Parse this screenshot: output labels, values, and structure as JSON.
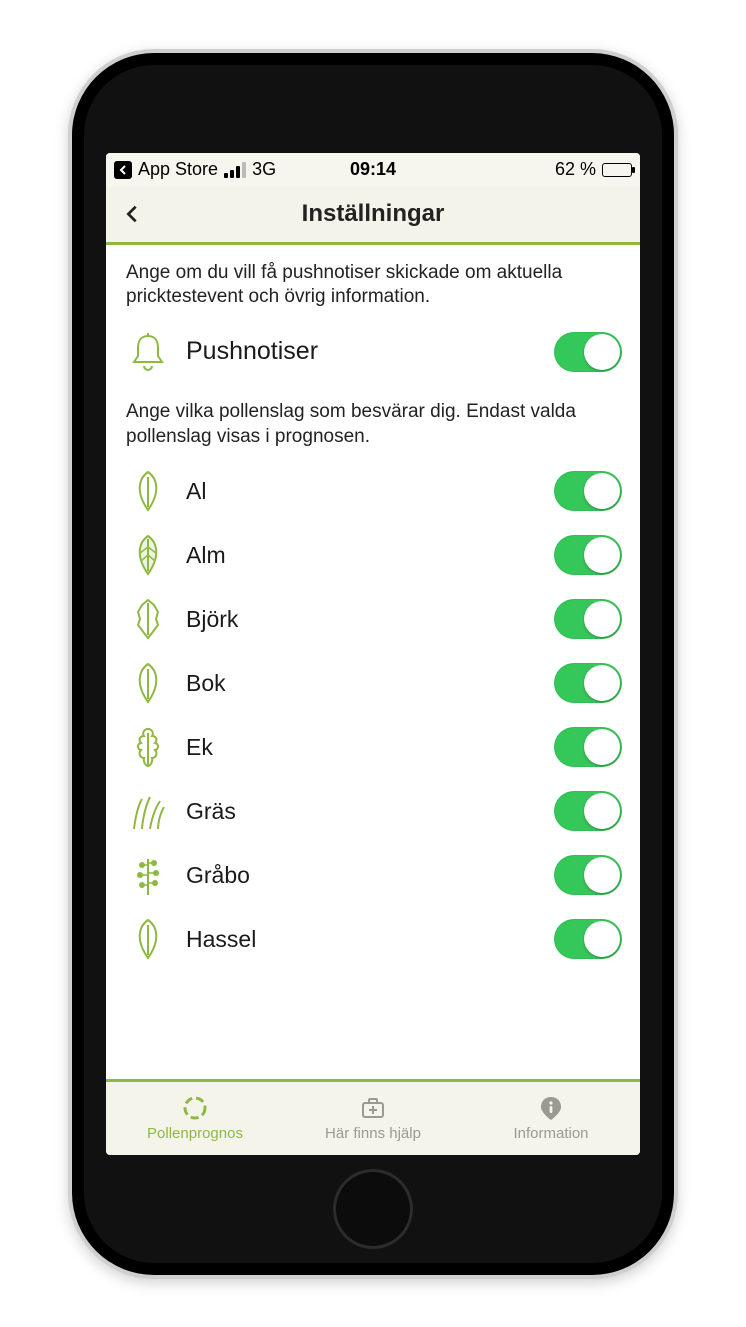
{
  "status_bar": {
    "back_app": "App Store",
    "network": "3G",
    "time": "09:14",
    "battery_pct": "62 %"
  },
  "header": {
    "title": "Inställningar"
  },
  "push": {
    "description": "Ange om du vill få pushnotiser skickade om aktuella pricktestevent och övrig information.",
    "label": "Pushnotiser",
    "enabled": true
  },
  "pollen_section": {
    "description": "Ange vilka pollenslag som besvärar dig. Endast valda pollenslag visas i prognosen."
  },
  "pollen": [
    {
      "id": "al",
      "label": "Al",
      "icon": "leaf-simple",
      "enabled": true
    },
    {
      "id": "alm",
      "label": "Alm",
      "icon": "leaf-veined",
      "enabled": true
    },
    {
      "id": "bjork",
      "label": "Björk",
      "icon": "leaf-birch",
      "enabled": true
    },
    {
      "id": "bok",
      "label": "Bok",
      "icon": "leaf-simple",
      "enabled": true
    },
    {
      "id": "ek",
      "label": "Ek",
      "icon": "leaf-oak",
      "enabled": true
    },
    {
      "id": "gras",
      "label": "Gräs",
      "icon": "grass",
      "enabled": true
    },
    {
      "id": "grabo",
      "label": "Gråbo",
      "icon": "sprig",
      "enabled": true
    },
    {
      "id": "hassel",
      "label": "Hassel",
      "icon": "leaf-simple",
      "enabled": true
    }
  ],
  "tabs": [
    {
      "id": "prognos",
      "label": "Pollenprognos",
      "icon": "ring",
      "active": true
    },
    {
      "id": "hjalp",
      "label": "Här finns hjälp",
      "icon": "medkit",
      "active": false
    },
    {
      "id": "info",
      "label": "Information",
      "icon": "infopin",
      "active": false
    }
  ],
  "colors": {
    "accent": "#8fb843",
    "switch_on": "#34c759",
    "bg_chrome": "#f5f4ea"
  }
}
